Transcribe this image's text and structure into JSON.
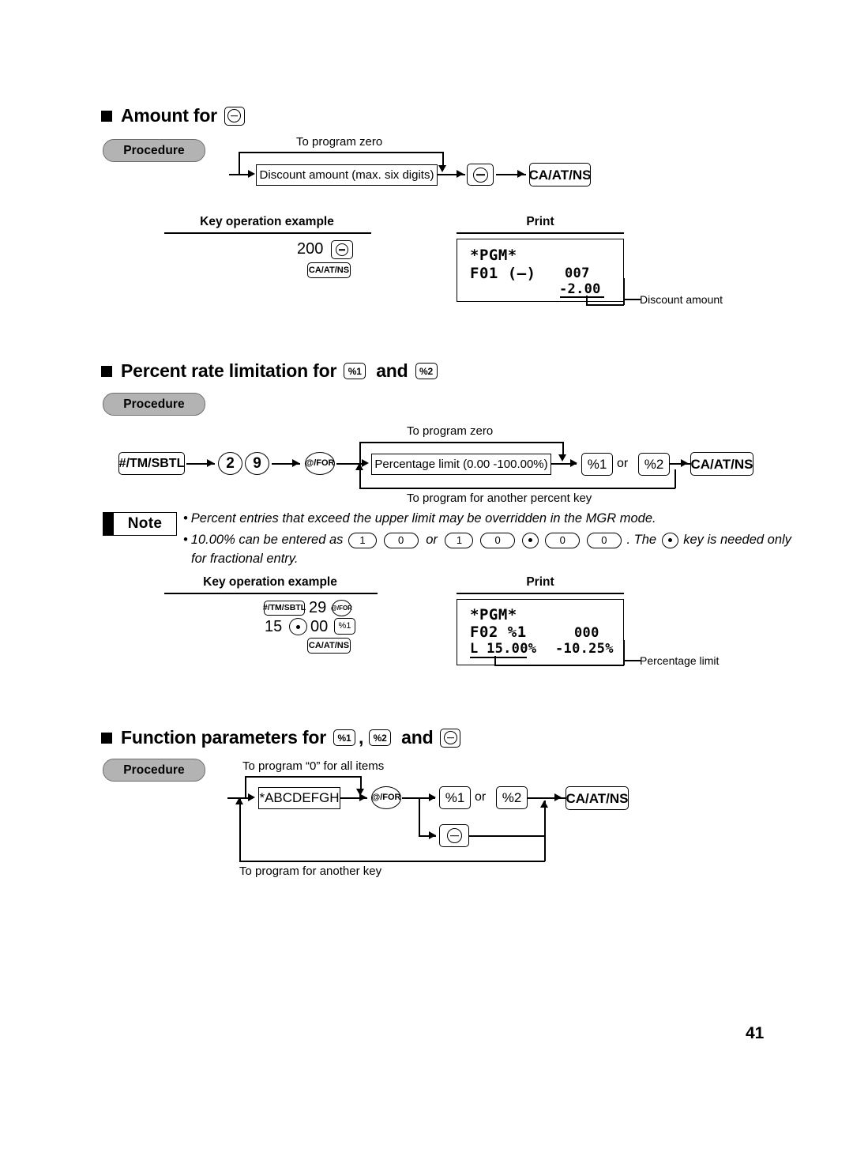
{
  "page": {
    "number": "41"
  },
  "sections": [
    {
      "id": "amount-for-minus",
      "heading_prefix": "Amount for",
      "heading_keys": [
        "minus"
      ],
      "procedure_label": "Procedure",
      "flow": {
        "loop_label_top": "To program zero",
        "box_label": "Discount amount (max. six digits)",
        "key_minus": "minus",
        "key_ca": "CA/AT/NS"
      },
      "example": {
        "col1_heading": "Key operation example",
        "col2_heading": "Print",
        "keys_line1_value": "200",
        "keys_line1_key": "minus",
        "keys_line2_key": "CA/AT/NS",
        "receipt": {
          "line1": "*PGM*",
          "line2_left": "F01 (—)",
          "line2_right": "007",
          "line3_right": "-2.00"
        },
        "callout": "Discount amount"
      }
    },
    {
      "id": "percent-rate-limitation",
      "heading_prefix": "Percent rate limitation for",
      "heading_key1": "%1",
      "heading_joiner": "and",
      "heading_key2": "%2",
      "procedure_label": "Procedure",
      "flow": {
        "key_sbtl": "#/TM/SBTL",
        "digit1": "2",
        "digit2": "9",
        "key_atfor": "@/FOR",
        "loop_label_top": "To program zero",
        "loop_label_bottom": "To program for another percent key",
        "box_label": "Percentage limit (0.00 -100.00%)",
        "key_pct1": "%1",
        "or_label": "or",
        "key_pct2": "%2",
        "key_ca": "CA/AT/NS"
      },
      "note": {
        "label": "Note",
        "bullet1": "Percent entries that exceed the upper limit may be overridden in the MGR mode.",
        "bullet2_part1": "10.00% can be entered as",
        "bullet2_keys_a": [
          "1",
          "0"
        ],
        "bullet2_or": "or",
        "bullet2_keys_b": [
          "1",
          "0",
          "·",
          "0",
          "0"
        ],
        "bullet2_part2": ".  The",
        "bullet2_key_dot": "·",
        "bullet2_part3": "key is needed only",
        "bullet2_part4": "for fractional entry."
      },
      "example": {
        "col1_heading": "Key operation example",
        "col2_heading": "Print",
        "keys_line1_key1": "#/TM/SBTL",
        "keys_line1_value": "29",
        "keys_line1_key2": "@/FOR",
        "keys_line2_value1": "15",
        "keys_line2_dot": "·",
        "keys_line2_value2": "00",
        "keys_line2_key": "%1",
        "keys_line3_key": "CA/AT/NS",
        "receipt": {
          "line1": "*PGM*",
          "line2_left": "F02 %1",
          "line2_right": "000",
          "line3_left": "L 15.00%",
          "line3_right": "-10.25%"
        },
        "callout": "Percentage limit"
      }
    },
    {
      "id": "function-parameters",
      "heading_prefix": "Function parameters for",
      "heading_key1": "%1",
      "heading_comma": ",",
      "heading_key2": "%2",
      "heading_joiner": "and",
      "heading_key3": "minus",
      "procedure_label": "Procedure",
      "flow": {
        "loop_label_top": "To program “0” for all items",
        "loop_label_bottom": "To program for another key",
        "box_label": "*ABCDEFGH",
        "key_atfor": "@/FOR",
        "key_pct1": "%1",
        "or_label": "or",
        "key_pct2": "%2",
        "key_minus": "minus",
        "key_ca": "CA/AT/NS"
      }
    }
  ]
}
